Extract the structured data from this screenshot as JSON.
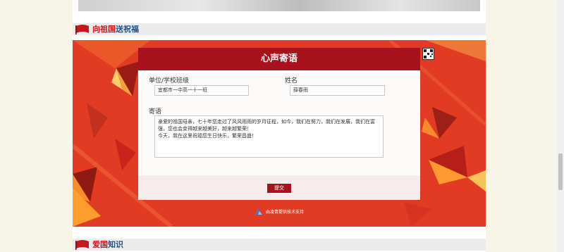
{
  "section1": {
    "title_part1": "向祖国",
    "title_part2": "送祝福"
  },
  "form": {
    "title": "心声寄语",
    "unit_label": "单位/学校班级",
    "unit_value": "宜都市一中高一十一班",
    "name_label": "姓名",
    "name_value": "薛春雨",
    "message_label": "寄语",
    "message_line1": "亲爱的祖国母亲，七十年您走过了风风雨雨的岁月征程，如今，我们在努力，我们在发展，我们在富",
    "message_line2": "强，您也会变得越来越美好，越来越繁荣！",
    "message_line3": "今天，我在这里祝福您生日快乐，繁荣昌盛！",
    "submit_label": "提交"
  },
  "footer": {
    "powered_text": "由凌青提供技术支持"
  },
  "section2": {
    "title_part1": "爱国",
    "title_part2": "知识"
  },
  "colors": {
    "banner_red": "#e23b23",
    "header_red": "#a8121c",
    "page_bg": "#f7f5e8"
  }
}
